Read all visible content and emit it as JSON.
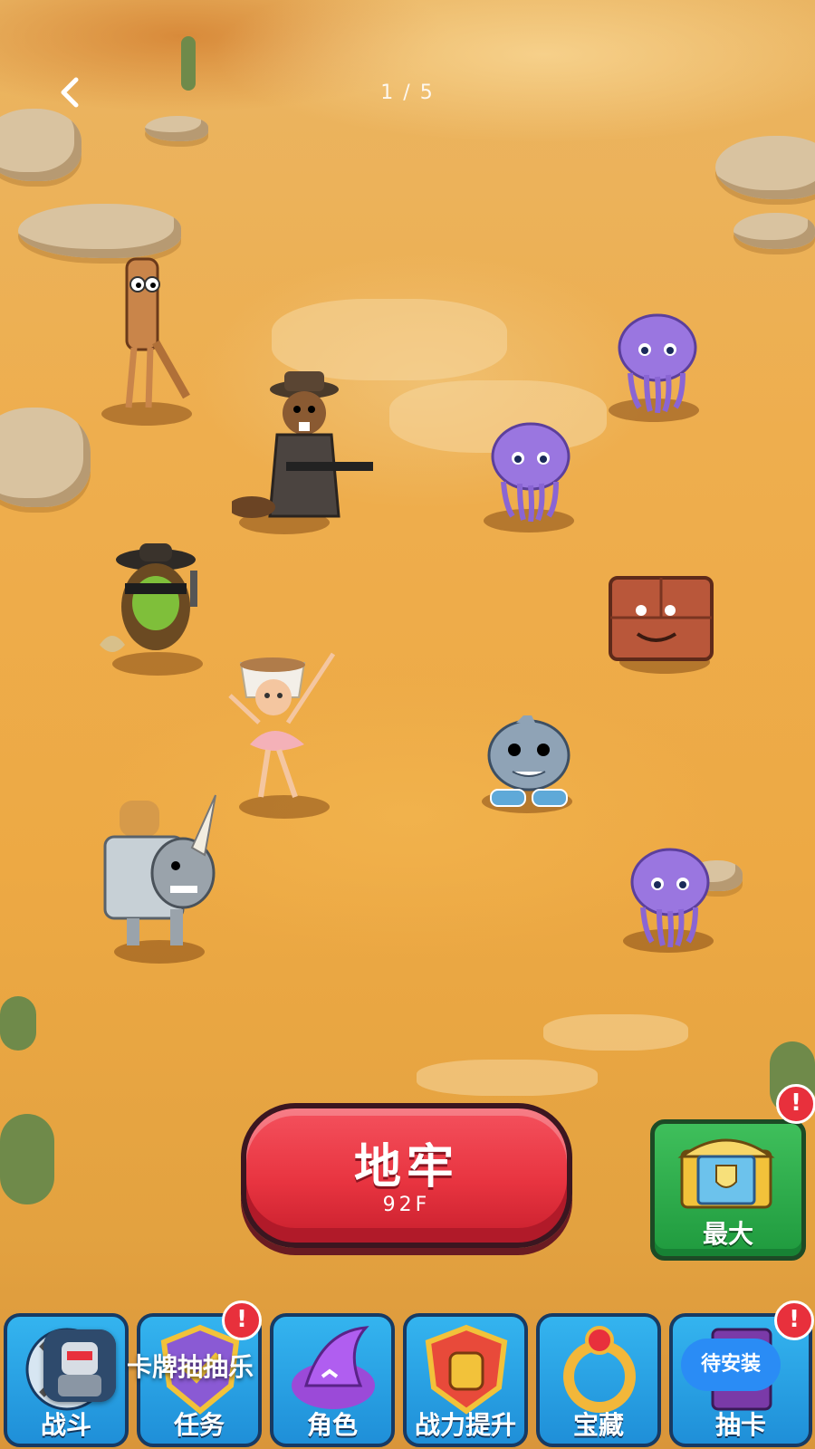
{
  "header": {
    "page_counter": "1 / 5"
  },
  "dungeon": {
    "title": "地牢",
    "floor": "92F"
  },
  "side_button": {
    "label": "最大",
    "badge": "!"
  },
  "tabs": [
    {
      "label": "战斗",
      "badge": ""
    },
    {
      "label": "任务",
      "badge": "!"
    },
    {
      "label": "角色",
      "badge": ""
    },
    {
      "label": "战力提升",
      "badge": ""
    },
    {
      "label": "宝藏",
      "badge": ""
    },
    {
      "label": "抽卡",
      "badge": "!"
    }
  ],
  "install_banner": {
    "app_name": "卡牌抽抽乐",
    "button_label": "待安装"
  },
  "units": {
    "allies": [
      "stick-man",
      "beaver-gangster",
      "kiwi-bandit",
      "coffee-ballerina",
      "toaster-rhino"
    ],
    "enemies": [
      "purple-jellyfish",
      "purple-jellyfish",
      "brick-block",
      "sneaker-shark",
      "purple-jellyfish"
    ]
  },
  "colors": {
    "dungeon_button": "#e83440",
    "tab_blue": "#2aa3e6",
    "badge_red": "#e8303c",
    "install_blue": "#2a8cf5"
  }
}
